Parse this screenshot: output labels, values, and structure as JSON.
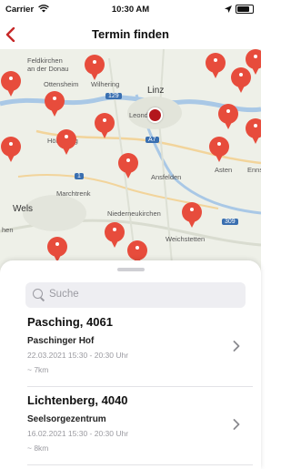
{
  "status_bar": {
    "carrier": "Carrier",
    "time": "10:30 AM",
    "signal_icon": "wifi-icon",
    "location_icon": "location-arrow-icon",
    "battery_icon": "battery-icon"
  },
  "nav": {
    "title": "Termin finden",
    "back_icon": "chevron-left-icon",
    "accent_color": "#c62828"
  },
  "map": {
    "labels": {
      "feldkirchen": "Feldkirchen",
      "an_der_donau": "an der Donau",
      "ottensheim": "Ottensheim",
      "wilhering": "Wilhering",
      "linz": "Linz",
      "leonding": "Leonding",
      "horsching": "Hörsching",
      "ansfelden": "Ansfelden",
      "asten": "Asten",
      "enns": "Enns",
      "marchtrenk": "Marchtrenk",
      "wels": "Wels",
      "niederneukirchen": "Niederneukirchen",
      "weichstetten": "Weichstetten",
      "hen": "hen",
      "road_129": "129",
      "road_a7": "A7",
      "road_1": "1",
      "road_309": "309"
    },
    "pin_color": "#e74c3c"
  },
  "sheet": {
    "search_placeholder": "Suche",
    "items": [
      {
        "location": "Pasching, 4061",
        "venue": "Paschinger Hof",
        "datetime": "22.03.2021 15:30 - 20:30 Uhr",
        "distance": "~ 7km"
      },
      {
        "location": "Lichtenberg, 4040",
        "venue": "Seelsorgezentrum",
        "datetime": "16.02.2021 15:30 - 20:30 Uhr",
        "distance": "~ 8km"
      }
    ]
  }
}
